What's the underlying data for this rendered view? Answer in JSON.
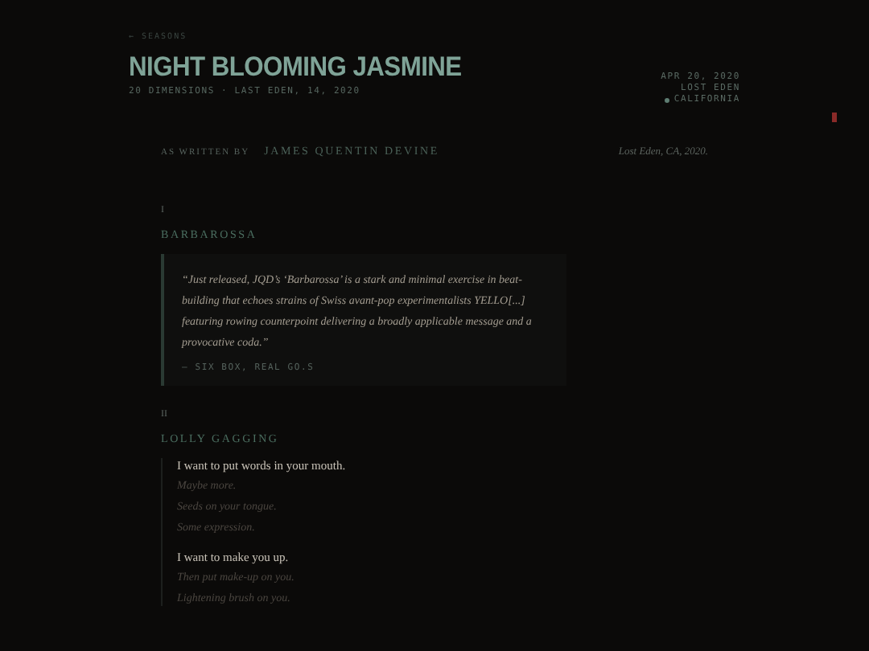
{
  "header": {
    "back_link": "← SEASONS",
    "title": "NIGHT BLOOMING JASMINE",
    "subtitle": "20 DIMENSIONS · LAST EDEN, 14, 2020",
    "meta": [
      "APR 20, 2020",
      "LOST EDEN"
    ],
    "location": "CALIFORNIA"
  },
  "byline": {
    "label": "AS WRITTEN BY",
    "author": "JAMES QUENTIN DEVINE",
    "place": "Lost Eden, CA, 2020."
  },
  "tracks": [
    {
      "number": "I",
      "title": "BARBAROSSA",
      "kind": "review",
      "quote": "“Just released, JQD’s ‘Barbarossa’ is a stark and minimal exercise in beat-building that echoes strains of Swiss avant-pop experimentalists YELLO[...] featuring rowing counterpoint delivering a broadly applicable message and a provocative coda.”",
      "source": "— SIX BOX, REAL GO.S"
    },
    {
      "number": "II",
      "title": "LOLLY GAGGING",
      "kind": "lyrics",
      "stanzas": [
        {
          "lead": "I want to put words in your mouth.",
          "lines": [
            "Maybe more.",
            "Seeds on your tongue.",
            "Some expression."
          ]
        },
        {
          "lead": "I want to make you up.",
          "lines": [
            "Then put make-up on you.",
            "Lightening brush on you."
          ]
        }
      ]
    }
  ]
}
